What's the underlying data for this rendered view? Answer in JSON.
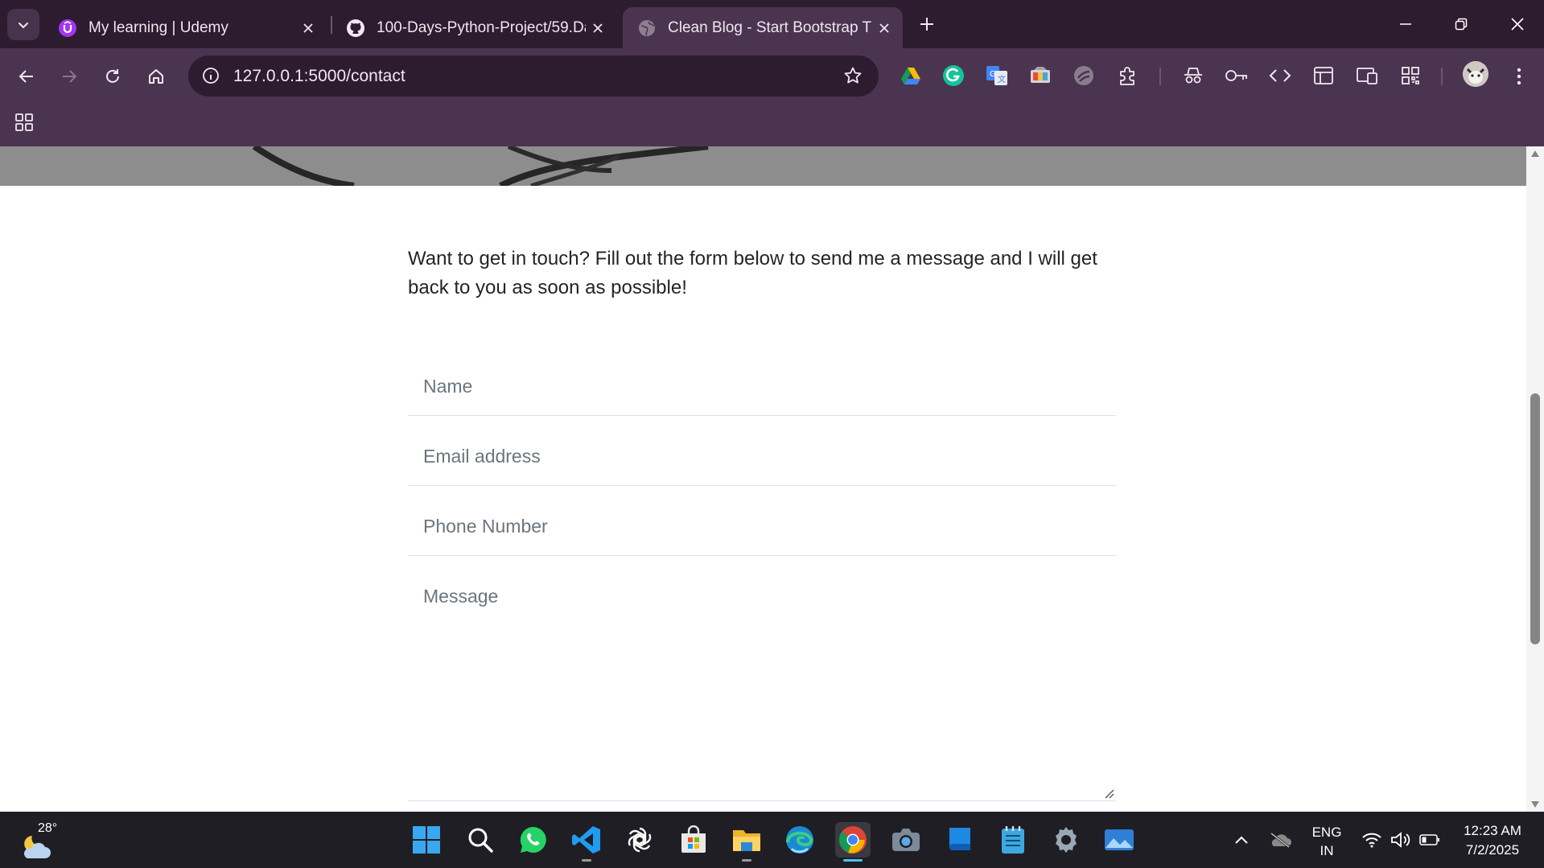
{
  "tabs": [
    {
      "title": "My learning | Udemy",
      "icon": "udemy-icon",
      "active": false
    },
    {
      "title": "100-Days-Python-Project/59.Da",
      "icon": "github-icon",
      "active": false
    },
    {
      "title": "Clean Blog - Start Bootstrap The",
      "icon": "globe-icon",
      "active": true
    }
  ],
  "address_bar": {
    "url": "127.0.0.1:5000/contact"
  },
  "extensions": [
    "google-drive-icon",
    "grammarly-icon",
    "google-translate-icon",
    "color-picker-icon",
    "shield-extension-icon",
    "extensions-puzzle-icon"
  ],
  "toolbar_tools": [
    "incognito-icon",
    "password-key-icon",
    "devtools-code-icon",
    "sidebar-layout-icon",
    "reading-mode-icon",
    "qr-code-icon"
  ],
  "page": {
    "intro": "Want to get in touch? Fill out the form below to send me a message and I will get back to you as soon as possible!",
    "form": {
      "name_placeholder": "Name",
      "email_placeholder": "Email address",
      "phone_placeholder": "Phone Number",
      "message_placeholder": "Message"
    }
  },
  "taskbar": {
    "weather": {
      "temp": "28°",
      "icon": "partly-cloudy-night-icon"
    },
    "apps": [
      "windows-start-icon",
      "search-icon",
      "whatsapp-icon",
      "vscode-icon",
      "chatgpt-icon",
      "microsoft-store-icon",
      "file-explorer-icon",
      "edge-icon",
      "chrome-icon",
      "camera-icon",
      "book-app-icon",
      "notepad-icon",
      "settings-icon",
      "photos-icon"
    ],
    "tray": {
      "lang_primary": "ENG",
      "lang_secondary": "IN"
    },
    "clock": {
      "time": "12:23 AM",
      "date": "7/2/2025"
    }
  },
  "colors": {
    "tab_strip": "#2d1b2f",
    "toolbar": "#4a3450",
    "omnibox": "#2d1b2f",
    "header_image": "#8e8d8e",
    "text": "#212529",
    "placeholder": "#6c757d",
    "taskbar": "#1f1e24"
  }
}
